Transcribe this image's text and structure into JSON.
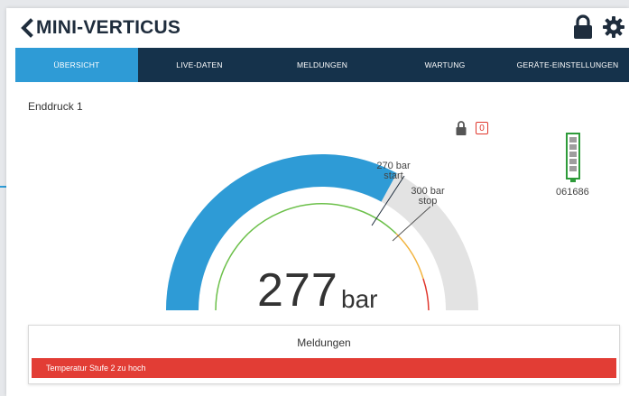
{
  "header": {
    "title": "MINI-VERTICUS",
    "back_icon": "chevron-left-icon",
    "lock_icon": "lock-icon",
    "settings_icon": "gear-icon"
  },
  "tabs": [
    {
      "label": "Übersicht",
      "active": true
    },
    {
      "label": "Live-Daten",
      "active": false
    },
    {
      "label": "Meldungen",
      "active": false
    },
    {
      "label": "Wartung",
      "active": false
    },
    {
      "label": "Geräte-Einstellungen",
      "active": false
    }
  ],
  "overview": {
    "section_label": "Enddruck 1",
    "lock_state_icon": "lock-icon",
    "counter_value": "0",
    "device_icon": "device-level-icon",
    "device_id": "061686"
  },
  "gauge": {
    "value": "277",
    "unit": "bar",
    "start_marker_value": "270 bar",
    "start_marker_label": "start",
    "stop_marker_value": "300 bar",
    "stop_marker_label": "stop",
    "colors": {
      "fill": "#2e9bd6",
      "track": "#e3e3e3",
      "green": "#6cc04a",
      "amber": "#f2b33d",
      "red": "#e0382e"
    }
  },
  "messages": {
    "title": "Meldungen",
    "alert_text": "Temperatur Stufe 2 zu hoch",
    "alert_color": "#e23d35"
  }
}
